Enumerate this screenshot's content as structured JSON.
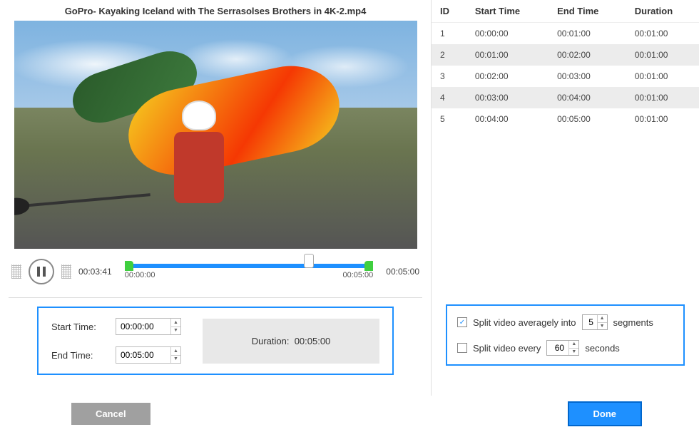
{
  "video": {
    "title": "GoPro- Kayaking Iceland with The Serrasolses Brothers in 4K-2.mp4",
    "currentTime": "00:03:41",
    "totalTime": "00:05:00",
    "rangeStart": "00:00:00",
    "rangeEnd": "00:05:00"
  },
  "timeBox": {
    "startLabel": "Start Time:",
    "startValue": "00:00:00",
    "endLabel": "End Time:",
    "endValue": "00:05:00",
    "durationLabel": "Duration:",
    "durationValue": "00:05:00"
  },
  "table": {
    "headers": {
      "id": "ID",
      "start": "Start Time",
      "end": "End Time",
      "dur": "Duration"
    },
    "rows": [
      {
        "id": "1",
        "start": "00:00:00",
        "end": "00:01:00",
        "dur": "00:01:00"
      },
      {
        "id": "2",
        "start": "00:01:00",
        "end": "00:02:00",
        "dur": "00:01:00"
      },
      {
        "id": "3",
        "start": "00:02:00",
        "end": "00:03:00",
        "dur": "00:01:00"
      },
      {
        "id": "4",
        "start": "00:03:00",
        "end": "00:04:00",
        "dur": "00:01:00"
      },
      {
        "id": "5",
        "start": "00:04:00",
        "end": "00:05:00",
        "dur": "00:01:00"
      }
    ]
  },
  "splitOptions": {
    "avgChecked": true,
    "avgPrefix": "Split video averagely into",
    "avgValue": "5",
    "avgSuffix": "segments",
    "everyChecked": false,
    "everyPrefix": "Split video every",
    "everyValue": "60",
    "everySuffix": "seconds"
  },
  "buttons": {
    "cancel": "Cancel",
    "done": "Done"
  }
}
